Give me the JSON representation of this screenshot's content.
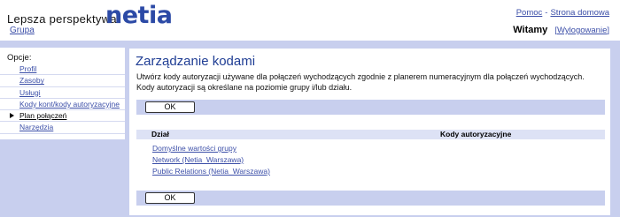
{
  "header": {
    "tagline": "Lepsza perspektywa",
    "logo": "netia",
    "help_link": "Pomoc",
    "separator": "-",
    "home_link": "Strona domowa",
    "group_link": "Grupa",
    "welcome": "Witamy",
    "logout_open": "[",
    "logout_link": "Wylogowanie",
    "logout_close": "]"
  },
  "sidebar": {
    "title": "Opcje:",
    "items": [
      {
        "label": "Profil"
      },
      {
        "label": "Zasoby"
      },
      {
        "label": "Usługi"
      },
      {
        "label": "Kody kont/kody autoryzacyjne"
      },
      {
        "label": "Plan połączeń",
        "active": true
      },
      {
        "label": "Narzędzia"
      }
    ]
  },
  "main": {
    "title": "Zarządzanie kodami",
    "description": "Utwórz kody autoryzacji używane dla połączeń wychodzących zgodnie z planerem numeracyjnym dla połączeń wychodzących. Kody autoryzacji są określane na poziomie grupy i/lub działu.",
    "ok_label": "OK",
    "table": {
      "columns": [
        "Dział",
        "Kody autoryzacyjne"
      ],
      "rows": [
        {
          "name": "Domyślne wartości grupy",
          "codes": ""
        },
        {
          "name": "Network (Netia_Warszawa)",
          "codes": ""
        },
        {
          "name": "Public Relations (Netia_Warszawa)",
          "codes": ""
        }
      ]
    }
  },
  "colors": {
    "frame": "#c8cfee",
    "link": "#3c4fa8",
    "title": "#1f3d94",
    "logo": "#2c4aa6"
  }
}
